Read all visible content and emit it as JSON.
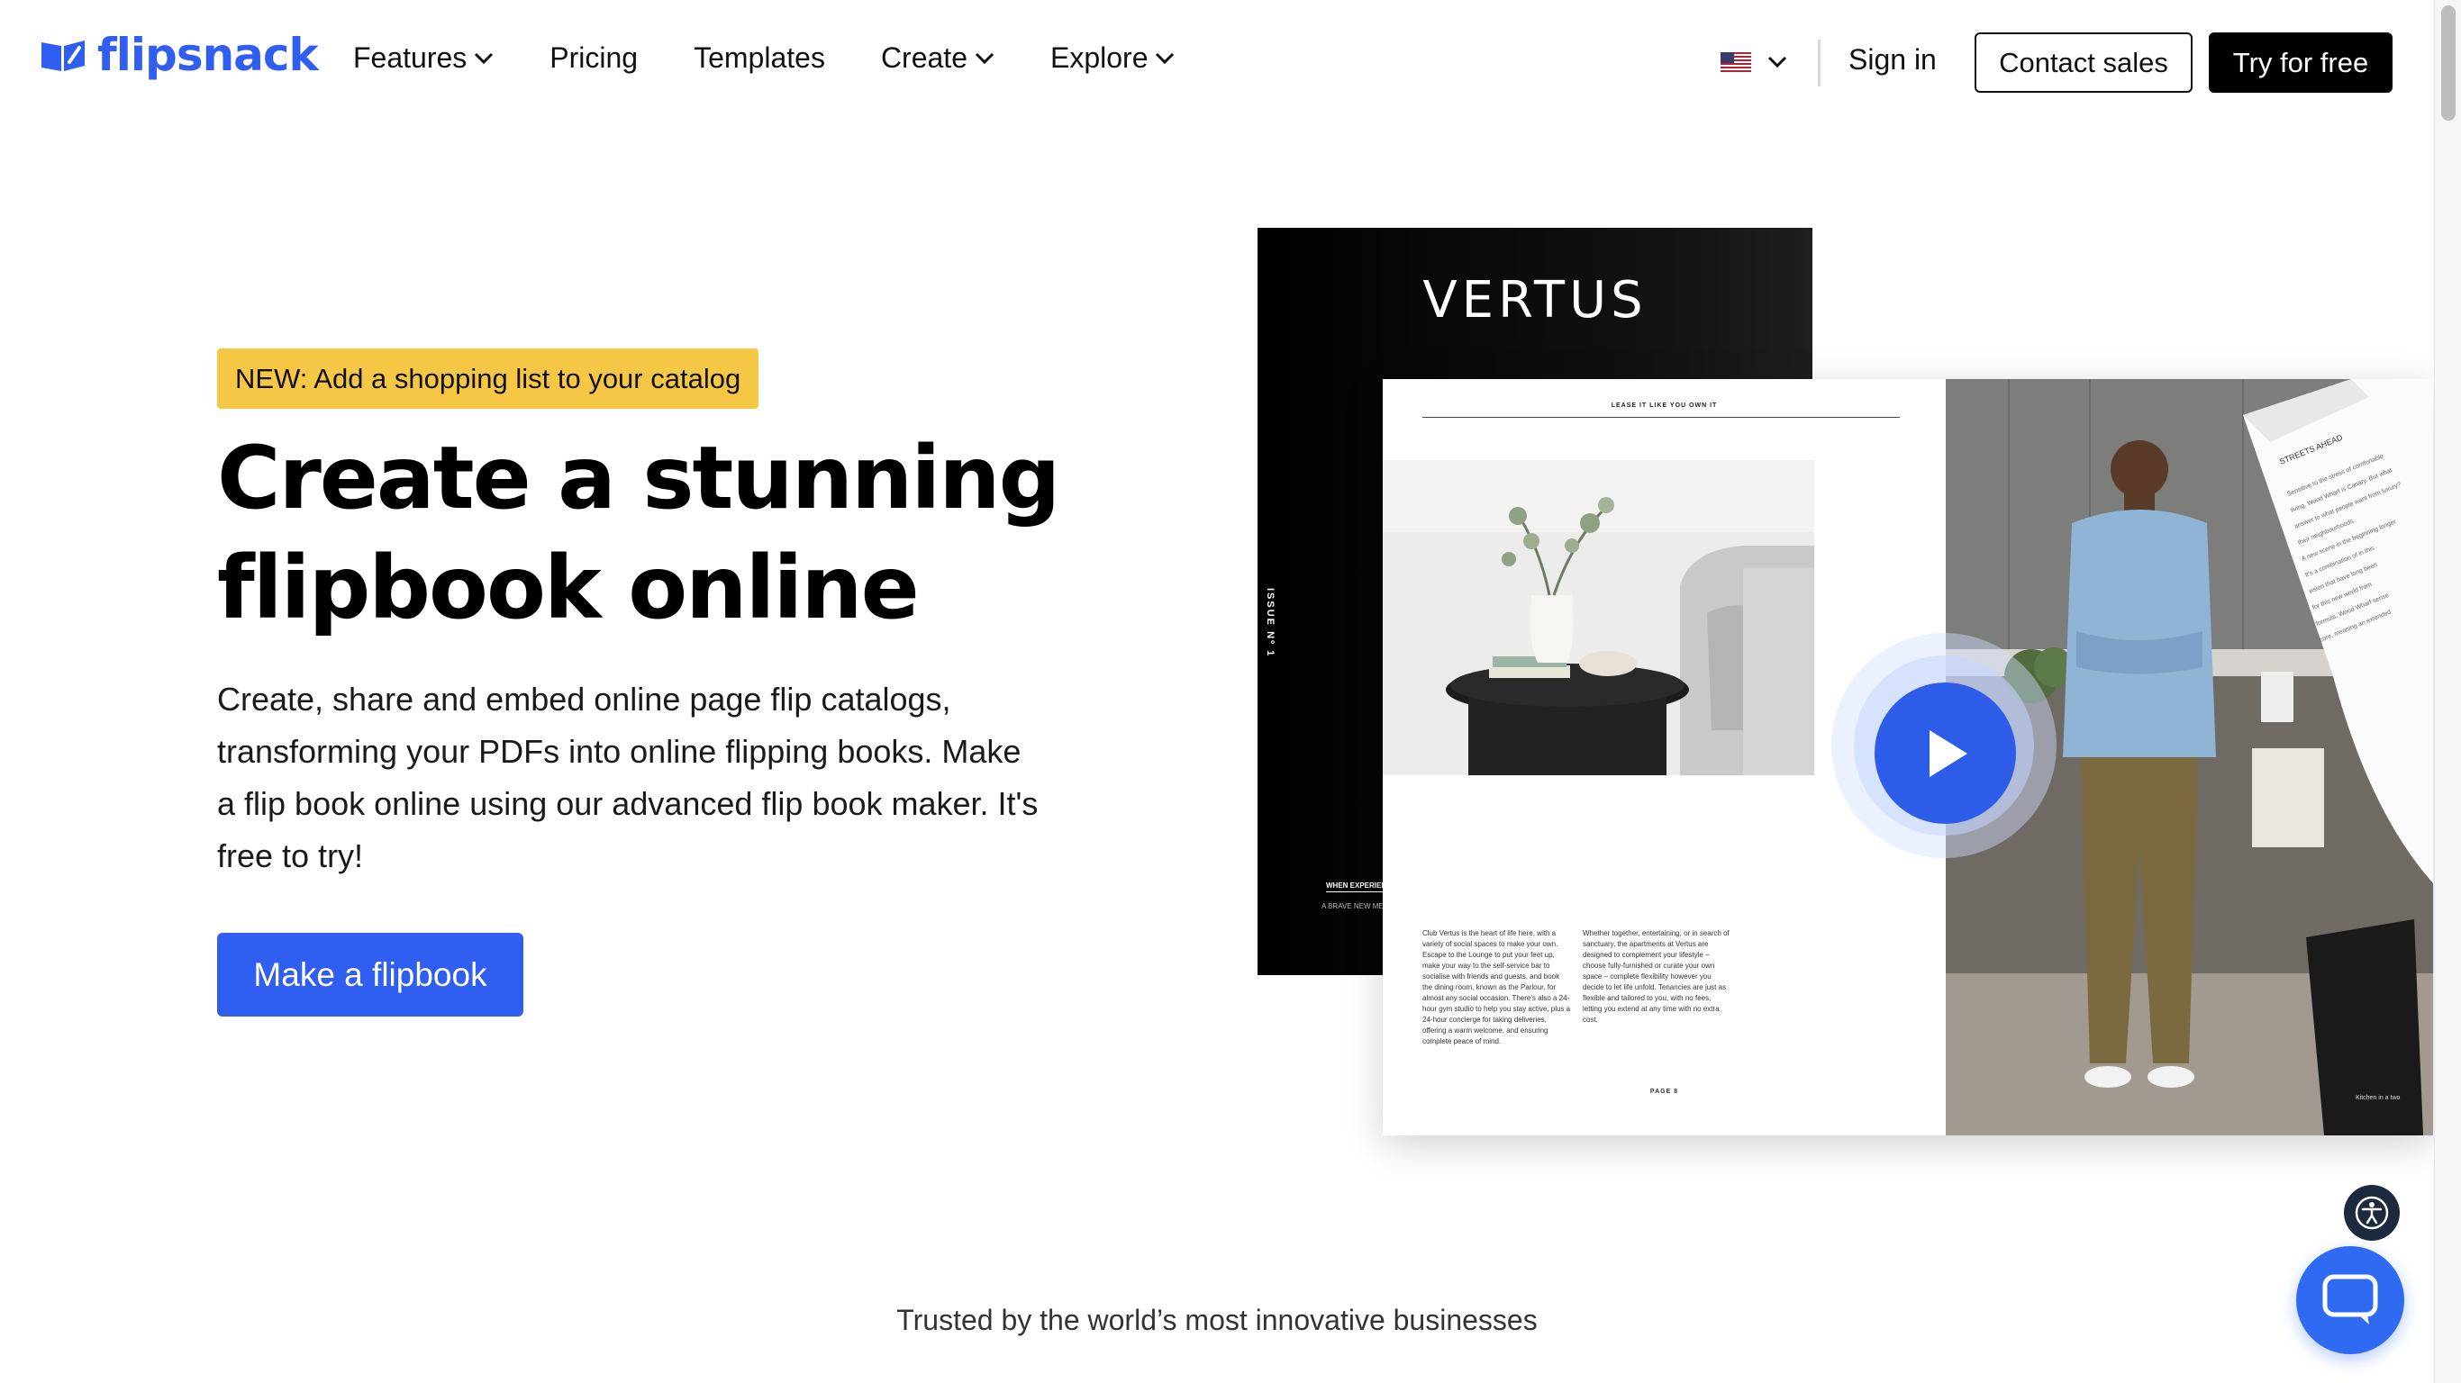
{
  "header": {
    "logo_text": "flipsnack",
    "nav": [
      {
        "label": "Features",
        "has_dropdown": true
      },
      {
        "label": "Pricing",
        "has_dropdown": false
      },
      {
        "label": "Templates",
        "has_dropdown": false
      },
      {
        "label": "Create",
        "has_dropdown": true
      },
      {
        "label": "Explore",
        "has_dropdown": true
      }
    ],
    "language_icon": "us-flag-icon",
    "sign_in": "Sign in",
    "contact_sales": "Contact sales",
    "try_free": "Try for free"
  },
  "hero": {
    "badge": "NEW: Add a shopping list to your catalog",
    "title_line1": "Create a stunning",
    "title_line2": "flipbook online",
    "description": "Create, share and embed online page flip catalogs, transforming your PDFs into online flipping books. Make a flip book online using our advanced flip book maker. It's free to try!",
    "cta": "Make a flipbook"
  },
  "magazine": {
    "cover_title": "VERTUS",
    "cover_issue": "ISSUE Nº 1",
    "cover_tagline": "WHEN EXPERIEN",
    "cover_subtext": "A BRAVE NEW MEANS LUXURY I",
    "page_kicker": "LEASE IT LIKE YOU OWN IT",
    "column_a": "Club Vertus is the heart of life here, with a variety of social spaces to make your own. Escape to the Lounge to put your feet up, make your way to the self-service bar to socialise with friends and guests, and book the dining room, known as the Parlour, for almost any social occasion. There's also a 24-hour gym studio to help you stay active, plus a 24-hour concierge for taking deliveries, offering a warm welcome, and ensuring complete peace of mind.",
    "column_b": "Whether together, entertaining, or in search of sanctuary, the apartments at Vertus are designed to complement your lifestyle – choose fully-furnished or curate your own space – complete flexibility however you decide to let life unfold. Tenancies are just as flexible and tailored to you, with no fees, letting you extend at any time with no extra cost.",
    "page_number": "PAGE 8",
    "streets_heading": "STREETS AHEAD",
    "streets_text": "Sensitive to the stress of comfortable living, Wood Wharf is Canary Wharf. But what answer to what people want from luxury? In a their neighbourhoods. A new scene in the beginning longer. It's a combination of in this vision that have long been for this new world from text. At the same time formula. Wood Wharf sense of keeping residential, forming a new sense of core, meaning an extended everyday delivery of fostering genuine and Streets help to make it takes a whole lot communities for the What is the shape",
    "kitchen_caption": "Kitchen in a two",
    "play_icon": "play-icon"
  },
  "trusted": "Trusted by the world’s most innovative businesses",
  "widgets": {
    "accessibility_icon": "accessibility-icon",
    "chat_icon": "chat-icon"
  },
  "colors": {
    "brand_blue": "#2f5ef0",
    "badge_yellow": "#f6c744",
    "black": "#000000"
  }
}
